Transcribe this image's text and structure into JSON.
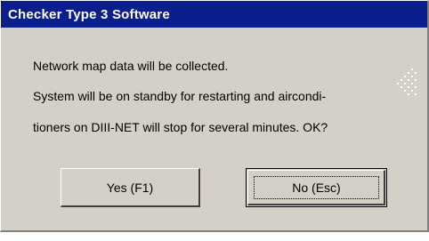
{
  "window": {
    "title": "Checker Type 3 Software"
  },
  "message": {
    "line1": "Network map data will be collected.",
    "line2": "System will be on standby for restarting and aircondi-",
    "line3": "tioners on DIII-NET will stop for several minutes. OK?"
  },
  "buttons": {
    "yes_label": "Yes (F1)",
    "no_label": "No (Esc)",
    "focused": "no"
  },
  "colors": {
    "titlebar": "#0a1f8c",
    "dialog_bg": "#d4d0c8"
  }
}
